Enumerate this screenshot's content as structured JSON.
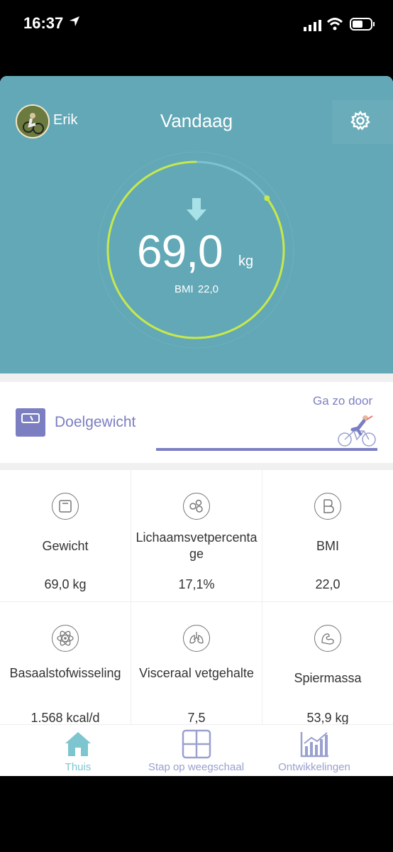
{
  "status_bar": {
    "time": "16:37",
    "location_icon": "location-arrow-icon",
    "signal_icon": "signal-icon",
    "wifi_icon": "wifi-icon",
    "battery_icon": "battery-icon"
  },
  "header": {
    "user_name": "Erik",
    "title": "Vandaag",
    "settings_icon": "gear-icon"
  },
  "today": {
    "weight": "69,0",
    "unit": "kg",
    "bmi_label": "BMI",
    "bmi_value": "22,0",
    "trend_icon": "arrow-down-icon",
    "ring_progress": 0.85
  },
  "goal": {
    "label": "Doelgewicht",
    "message": "Ga zo door",
    "icon": "scale-icon",
    "illustration": "cyclist-icon"
  },
  "metrics": [
    {
      "label": "Gewicht",
      "value": "69,0 kg",
      "icon": "scale-icon"
    },
    {
      "label": "Lichaamsvetpercentage",
      "value": "17,1%",
      "icon": "fat-cells-icon"
    },
    {
      "label": "BMI",
      "value": "22,0",
      "icon": "bmi-b-icon"
    },
    {
      "label": "Basaalstofwisseling",
      "value": "1.568 kcal/d",
      "icon": "atom-icon"
    },
    {
      "label": "Visceraal vetgehalte",
      "value": "7,5",
      "icon": "lungs-icon"
    },
    {
      "label": "Spiermassa",
      "value": "53,9 kg",
      "icon": "muscle-arm-icon"
    }
  ],
  "tabs": [
    {
      "label": "Thuis",
      "icon": "home-icon",
      "active": true
    },
    {
      "label": "Stap op weegschaal",
      "icon": "scale-grid-icon",
      "active": false
    },
    {
      "label": "Ontwikkelingen",
      "icon": "chart-trend-icon",
      "active": false
    }
  ],
  "colors": {
    "hero": "#62a8b6",
    "accent": "#7b7fc2",
    "ring": "#c7e84a",
    "tab_active": "#7dc5cf",
    "tab_inactive": "#9aa0cf"
  }
}
